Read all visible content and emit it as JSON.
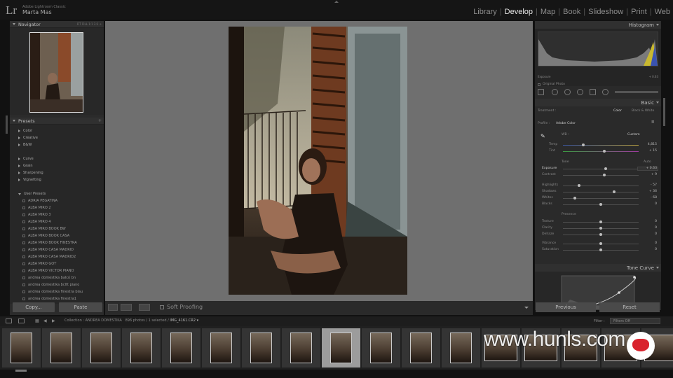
{
  "app": {
    "logo": "Lr",
    "product": "Adobe Lightroom Classic",
    "user": "Marta Mas"
  },
  "modules": [
    "Library",
    "Develop",
    "Map",
    "Book",
    "Slideshow",
    "Print",
    "Web"
  ],
  "active_module": "Develop",
  "left_panel": {
    "navigator_title": "Navigator",
    "zoom_options": "FIT  FILL  1:1  3:1  ÷",
    "presets_title": "Presets",
    "preset_groups_top": [
      "Color",
      "Creative",
      "B&W"
    ],
    "preset_groups_mid": [
      "Curve",
      "Grain",
      "Sharpening",
      "Vignetting"
    ],
    "user_presets_title": "User Presets",
    "user_presets": [
      "ADRIA PEGATINA",
      "ALBA MIRO 2",
      "ALBA MIRO 3",
      "ALBA MIRO 4",
      "ALBA MIRO BOOK BW",
      "ALBA MIRO BOOK CASA",
      "ALBA MIRO BOOK FINESTRA",
      "ALBA MIRO CASA MADRID",
      "ALBA MIRO CASA MADRID2",
      "ALBA MIRO GOT",
      "ALBA MIRO VICTOR PIANO",
      "andrea domestika balcó bn",
      "andrea domestika bcltt piano",
      "andrea domestika finestra blau",
      "andrea domestika finestra1"
    ],
    "copy_label": "Copy...",
    "paste_label": "Paste"
  },
  "toolbar": {
    "soft_proofing": "Soft Proofing"
  },
  "right_panel": {
    "histogram_title": "Histogram",
    "histogram_left": "Exposure",
    "histogram_right": "+ 0.63",
    "original_photo": "Original Photo",
    "basic_title": "Basic",
    "treatment_label": "Treatment :",
    "treatment_color": "Color",
    "treatment_bw": "Black & White",
    "profile_label": "Profile :",
    "profile_value": "Adobe Color",
    "wb_label": "WB :",
    "wb_value": "Custom",
    "temp_label": "Temp",
    "temp_value": "4,815",
    "tint_label": "Tint",
    "tint_value": "+ 15",
    "tone_label": "Tone",
    "tone_auto": "Auto",
    "exposure_label": "Exposure",
    "exposure_value": "+ 0.63",
    "contrast_label": "Contrast",
    "contrast_value": "+ 9",
    "highlights_label": "Highlights",
    "highlights_value": "- 57",
    "shadows_label": "Shadows",
    "shadows_value": "+ 36",
    "whites_label": "Whites",
    "whites_value": "- 68",
    "blacks_label": "Blacks",
    "blacks_value": "0",
    "presence_label": "Presence",
    "texture_label": "Texture",
    "texture_value": "0",
    "clarity_label": "Clarity",
    "clarity_value": "0",
    "dehaze_label": "Dehaze",
    "dehaze_value": "0",
    "vibrance_label": "Vibrance",
    "vibrance_value": "0",
    "saturation_label": "Saturation",
    "saturation_value": "0",
    "tone_curve_title": "Tone Curve",
    "previous_label": "Previous",
    "reset_label": "Reset"
  },
  "filmstrip": {
    "collection": "Collection : ANDREA DOMESTIKA",
    "counts": "896 photos / 1 selected /",
    "filename": "IMG_4161.CR2 ▾",
    "filter_label": "Filter :",
    "filter_value": "Filters Off"
  },
  "watermark": "www.hunls.com"
}
